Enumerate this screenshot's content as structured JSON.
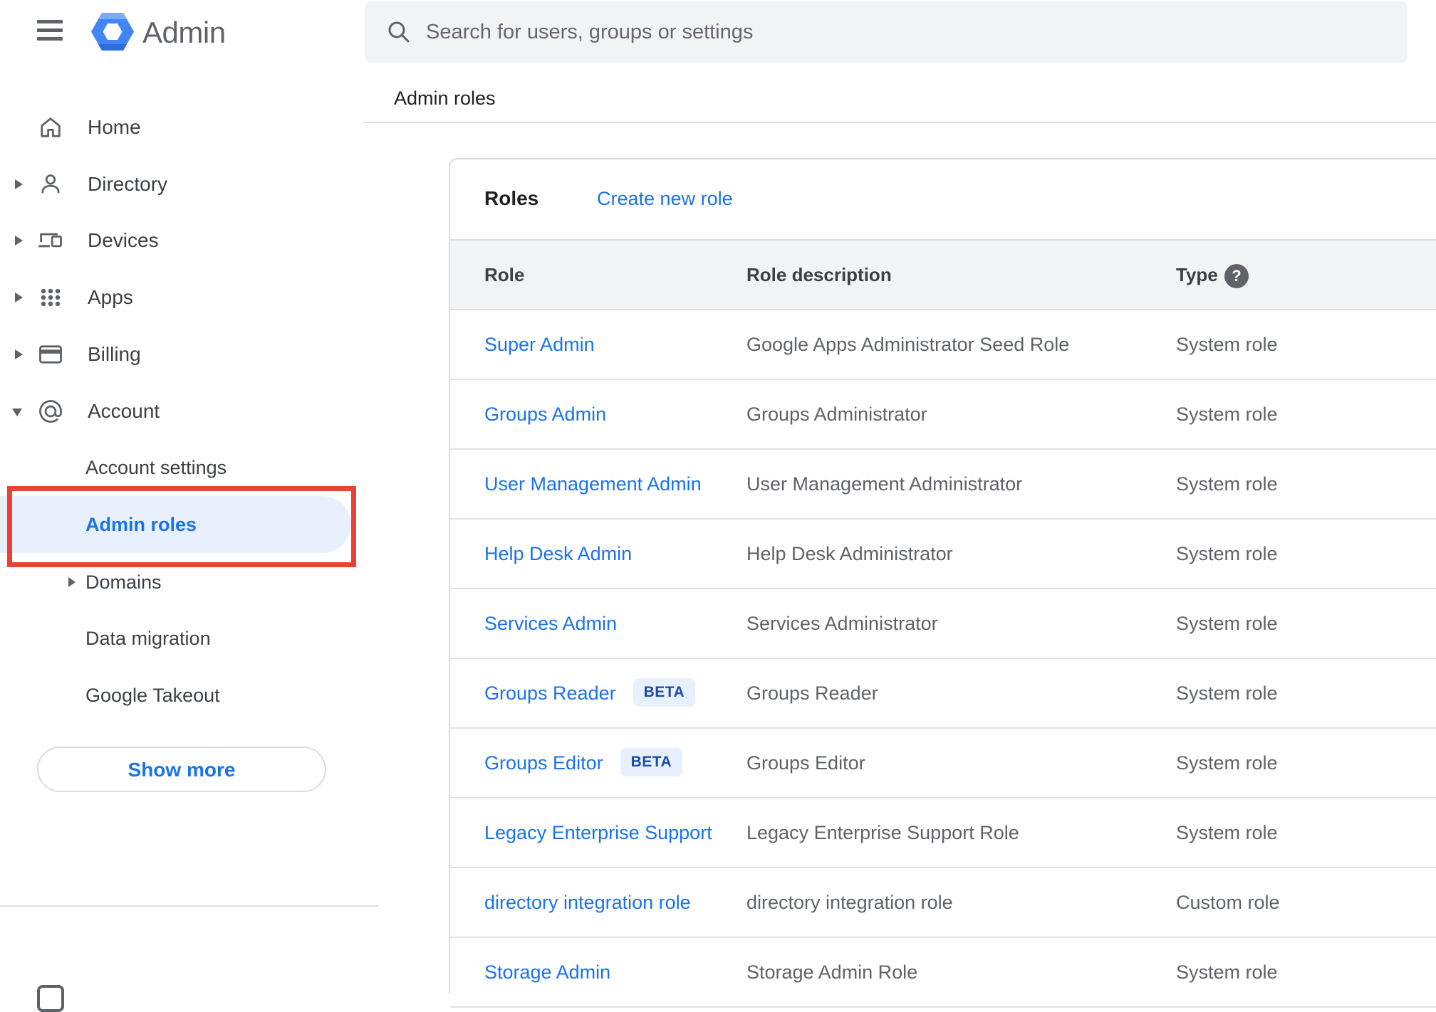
{
  "app": {
    "title": "Admin"
  },
  "search": {
    "placeholder": "Search for users, groups or settings"
  },
  "breadcrumb": "Admin roles",
  "sidebar": {
    "items": [
      {
        "label": "Home"
      },
      {
        "label": "Directory"
      },
      {
        "label": "Devices"
      },
      {
        "label": "Apps"
      },
      {
        "label": "Billing"
      },
      {
        "label": "Account"
      }
    ],
    "account_children": [
      {
        "label": "Account settings"
      },
      {
        "label": "Admin roles",
        "selected": true
      },
      {
        "label": "Domains"
      },
      {
        "label": "Data migration"
      },
      {
        "label": "Google Takeout"
      }
    ],
    "show_more_label": "Show more"
  },
  "main": {
    "card_title": "Roles",
    "create_link": "Create new role",
    "table": {
      "headers": [
        "Role",
        "Role description",
        "Type"
      ],
      "rows": [
        {
          "role": "Super Admin",
          "description": "Google Apps Administrator Seed Role",
          "type": "System role"
        },
        {
          "role": "Groups Admin",
          "description": "Groups Administrator",
          "type": "System role"
        },
        {
          "role": "User Management Admin",
          "description": "User Management Administrator",
          "type": "System role"
        },
        {
          "role": "Help Desk Admin",
          "description": "Help Desk Administrator",
          "type": "System role"
        },
        {
          "role": "Services Admin",
          "description": "Services Administrator",
          "type": "System role"
        },
        {
          "role": "Groups Reader",
          "badge": "BETA",
          "description": "Groups Reader",
          "type": "System role"
        },
        {
          "role": "Groups Editor",
          "badge": "BETA",
          "description": "Groups Editor",
          "type": "System role"
        },
        {
          "role": "Legacy Enterprise Support",
          "description": "Legacy Enterprise Support Role",
          "type": "System role"
        },
        {
          "role": "directory integration role",
          "description": "directory integration role",
          "type": "Custom role"
        },
        {
          "role": "Storage Admin",
          "description": "Storage Admin Role",
          "type": "System role"
        }
      ]
    }
  },
  "colors": {
    "accent": "#1a73e8",
    "annotation_red": "#ea4335",
    "selected_bg": "#e8f0fe",
    "badge_bg": "#e8f0fe",
    "badge_text": "#174ea6"
  }
}
